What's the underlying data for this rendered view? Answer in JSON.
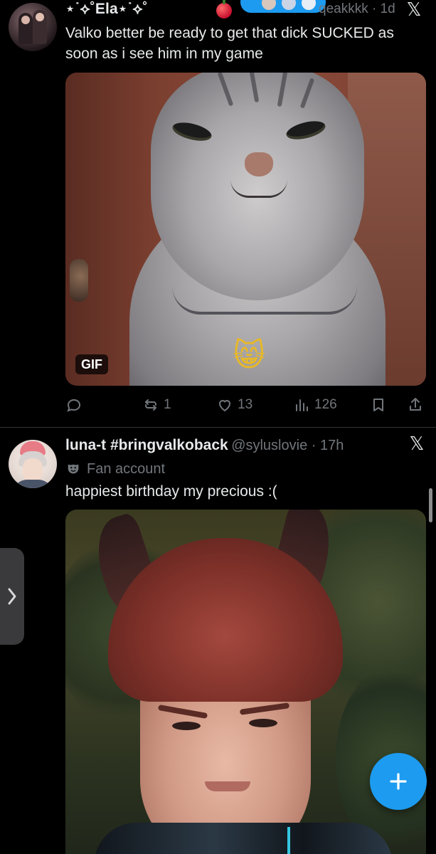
{
  "tweet1": {
    "name": "⋆˙⟡˚Ela⋆˙⟡˚",
    "handle": "qeakkkk · 1d",
    "text": "Valko better be ready to get that dick SUCKED as soon as i see him in my game",
    "media_badge": "GIF",
    "actions": {
      "reply_count": "",
      "repost_count": "1",
      "like_count": "13",
      "view_count": "126"
    }
  },
  "tweet2": {
    "name": "luna-t #bringvalkoback",
    "handle": "@syluslovie · 17h",
    "label": "Fan account",
    "text": "happiest birthday my precious :("
  },
  "icons": {
    "x_logo": "𝕏",
    "cat_emoji": "😸"
  },
  "colors": {
    "accent": "#1d9bf0",
    "background": "#000000",
    "muted": "#71767b",
    "text": "#e7e9ea"
  }
}
